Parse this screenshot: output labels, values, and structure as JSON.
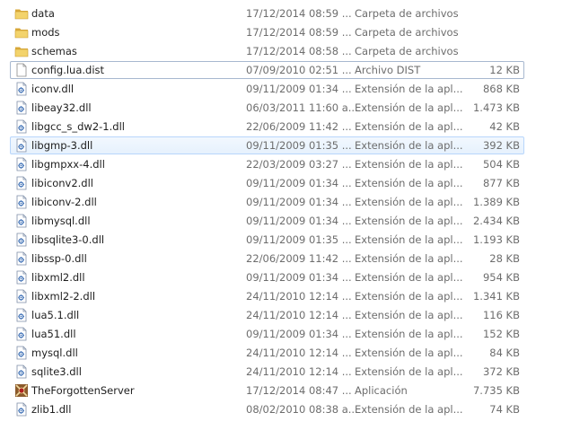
{
  "files": [
    {
      "name": "data",
      "date": "17/12/2014 08:59 ...",
      "type": "Carpeta de archivos",
      "size": "",
      "icon": "folder-icon"
    },
    {
      "name": "mods",
      "date": "17/12/2014 08:59 ...",
      "type": "Carpeta de archivos",
      "size": "",
      "icon": "folder-icon"
    },
    {
      "name": "schemas",
      "date": "17/12/2014 08:58 ...",
      "type": "Carpeta de archivos",
      "size": "",
      "icon": "folder-icon"
    },
    {
      "name": "config.lua.dist",
      "date": "07/09/2010 02:51 ...",
      "type": "Archivo DIST",
      "size": "12 KB",
      "icon": "file-icon"
    },
    {
      "name": "iconv.dll",
      "date": "09/11/2009 01:34 ...",
      "type": "Extensión de la apl...",
      "size": "868 KB",
      "icon": "dll-icon"
    },
    {
      "name": "libeay32.dll",
      "date": "06/03/2011 11:60 a...",
      "type": "Extensión de la apl...",
      "size": "1.473 KB",
      "icon": "dll-icon"
    },
    {
      "name": "libgcc_s_dw2-1.dll",
      "date": "22/06/2009 11:42 ...",
      "type": "Extensión de la apl...",
      "size": "42 KB",
      "icon": "dll-icon"
    },
    {
      "name": "libgmp-3.dll",
      "date": "09/11/2009 01:35 ...",
      "type": "Extensión de la apl...",
      "size": "392 KB",
      "icon": "dll-icon"
    },
    {
      "name": "libgmpxx-4.dll",
      "date": "22/03/2009 03:27 ...",
      "type": "Extensión de la apl...",
      "size": "504 KB",
      "icon": "dll-icon"
    },
    {
      "name": "libiconv2.dll",
      "date": "09/11/2009 01:34 ...",
      "type": "Extensión de la apl...",
      "size": "877 KB",
      "icon": "dll-icon"
    },
    {
      "name": "libiconv-2.dll",
      "date": "09/11/2009 01:34 ...",
      "type": "Extensión de la apl...",
      "size": "1.389 KB",
      "icon": "dll-icon"
    },
    {
      "name": "libmysql.dll",
      "date": "09/11/2009 01:34 ...",
      "type": "Extensión de la apl...",
      "size": "2.434 KB",
      "icon": "dll-icon"
    },
    {
      "name": "libsqlite3-0.dll",
      "date": "09/11/2009 01:35 ...",
      "type": "Extensión de la apl...",
      "size": "1.193 KB",
      "icon": "dll-icon"
    },
    {
      "name": "libssp-0.dll",
      "date": "22/06/2009 11:42 ...",
      "type": "Extensión de la apl...",
      "size": "28 KB",
      "icon": "dll-icon"
    },
    {
      "name": "libxml2.dll",
      "date": "09/11/2009 01:34 ...",
      "type": "Extensión de la apl...",
      "size": "954 KB",
      "icon": "dll-icon"
    },
    {
      "name": "libxml2-2.dll",
      "date": "24/11/2010 12:14 ...",
      "type": "Extensión de la apl...",
      "size": "1.341 KB",
      "icon": "dll-icon"
    },
    {
      "name": "lua5.1.dll",
      "date": "24/11/2010 12:14 ...",
      "type": "Extensión de la apl...",
      "size": "116 KB",
      "icon": "dll-icon"
    },
    {
      "name": "lua51.dll",
      "date": "09/11/2009 01:34 ...",
      "type": "Extensión de la apl...",
      "size": "152 KB",
      "icon": "dll-icon"
    },
    {
      "name": "mysql.dll",
      "date": "24/11/2010 12:14 ...",
      "type": "Extensión de la apl...",
      "size": "84 KB",
      "icon": "dll-icon"
    },
    {
      "name": "sqlite3.dll",
      "date": "24/11/2010 12:14 ...",
      "type": "Extensión de la apl...",
      "size": "372 KB",
      "icon": "dll-icon"
    },
    {
      "name": "TheForgottenServer",
      "date": "17/12/2014 08:47 ...",
      "type": "Aplicación",
      "size": "7.735 KB",
      "icon": "app-icon"
    },
    {
      "name": "zlib1.dll",
      "date": "08/02/2010 08:38 a...",
      "type": "Extensión de la apl...",
      "size": "74 KB",
      "icon": "dll-icon"
    }
  ],
  "highlighted_rows": [
    3,
    7
  ],
  "colors": {
    "focus_border": "#a7b8cf",
    "hover_border": "#b8d6fb",
    "folder": "#e8c255",
    "date_text": "#6d6d6d"
  }
}
